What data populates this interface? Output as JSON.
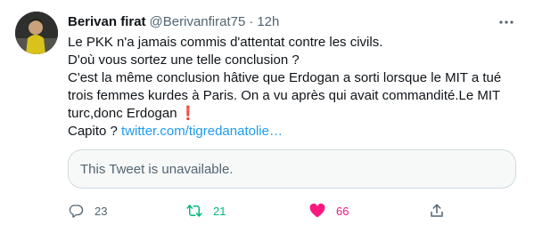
{
  "author": {
    "name": "Berivan firat",
    "handle": "@Berivanfirat75",
    "separator": "·",
    "time": "12h"
  },
  "tweet_text": {
    "line1": "Le PKK n'a jamais commis d'attentat contre les civils.",
    "line2": "D'où vous sortez une telle conclusion ?",
    "line3": "C'est la même conclusion hâtive que Erdogan a sorti lorsque le MIT a tué",
    "line4": "trois femmes kurdes à Paris. On a vu après qui avait commandité.Le MIT",
    "line5": "turc,donc Erdogan",
    "line5_emoji": "❗",
    "line6_prefix": "Capito ?",
    "link": "twitter.com/tigredanatolie…"
  },
  "quoted_tweet": {
    "text": "This Tweet is unavailable."
  },
  "actions": {
    "reply_count": "23",
    "retweet_count": "21",
    "like_count": "66"
  },
  "icons": {
    "reply": "reply-icon",
    "retweet": "retweet-icon",
    "like": "heart-icon",
    "share": "share-icon",
    "more": "more-icon"
  },
  "colors": {
    "link": "#1d9bf0",
    "retweet_active": "#00ba7c",
    "like_active": "#f91880",
    "secondary_text": "#536471",
    "border": "#cfd9de"
  }
}
